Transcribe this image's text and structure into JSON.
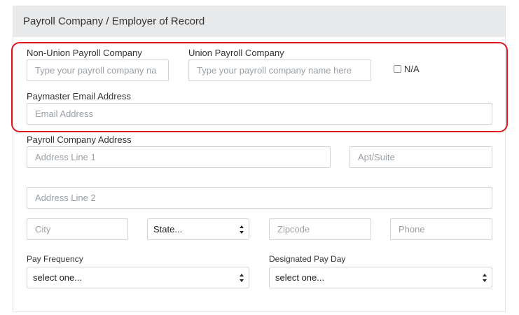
{
  "panel": {
    "title": "Payroll Company / Employer of Record"
  },
  "fields": {
    "non_union_label": "Non-Union Payroll Company",
    "non_union_placeholder": "Type your payroll company na",
    "union_label": "Union Payroll Company",
    "union_placeholder": "Type your payroll company name here",
    "na_label": "N/A",
    "na_checked": false,
    "paymaster_label": "Paymaster Email Address",
    "paymaster_placeholder": "Email Address",
    "address_label": "Payroll Company Address",
    "address1_placeholder": "Address Line 1",
    "apt_placeholder": "Apt/Suite",
    "address2_placeholder": "Address Line 2",
    "city_placeholder": "City",
    "state_value": "State...",
    "zip_placeholder": "Zipcode",
    "phone_placeholder": "Phone",
    "pay_frequency_label": "Pay Frequency",
    "pay_frequency_value": "select one...",
    "pay_day_label": "Designated Pay Day",
    "pay_day_value": "select one..."
  },
  "colors": {
    "highlight": "#e0141e",
    "header_bg": "#e8e9ea",
    "input_border": "#cfd3d6"
  },
  "icons": {
    "select_arrows": "up-down-chevron-icon",
    "checkbox": "checkbox-icon"
  }
}
